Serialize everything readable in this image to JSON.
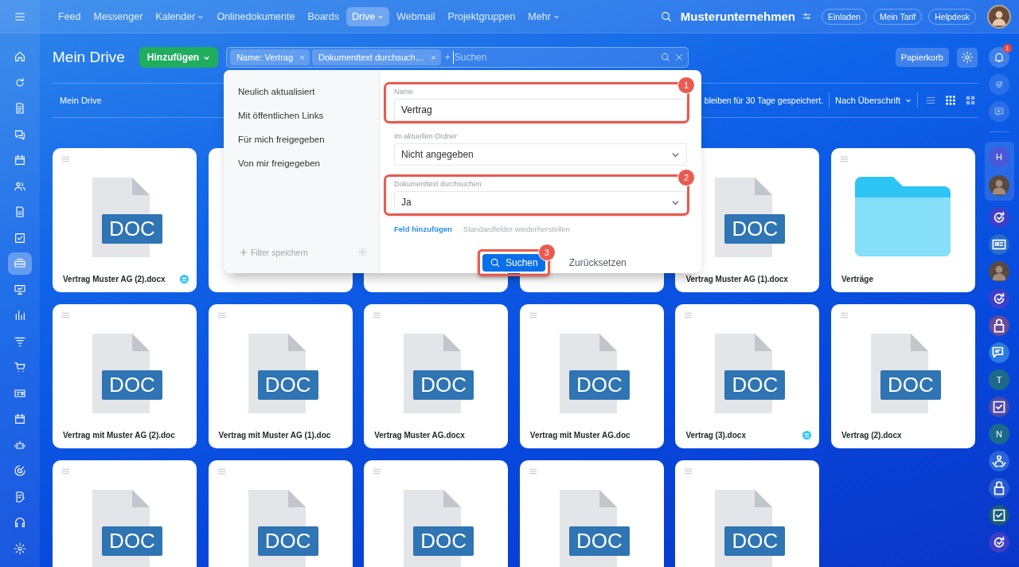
{
  "nav": {
    "items": [
      {
        "label": "Feed",
        "selected": false,
        "dropdown": false
      },
      {
        "label": "Messenger",
        "selected": false,
        "dropdown": false
      },
      {
        "label": "Kalender",
        "selected": false,
        "dropdown": true
      },
      {
        "label": "Onlinedokumente",
        "selected": false,
        "dropdown": false
      },
      {
        "label": "Boards",
        "selected": false,
        "dropdown": false
      },
      {
        "label": "Drive",
        "selected": true,
        "dropdown": true
      },
      {
        "label": "Webmail",
        "selected": false,
        "dropdown": false
      },
      {
        "label": "Projektgruppen",
        "selected": false,
        "dropdown": false
      },
      {
        "label": "Mehr",
        "selected": false,
        "dropdown": true
      }
    ],
    "company": "Musterunternehmen",
    "buttons": [
      "Einladen",
      "Mein Tarif",
      "Helpdesk"
    ]
  },
  "sidebar": [
    {
      "kind": "home",
      "selected": false
    },
    {
      "kind": "refresh",
      "selected": false
    },
    {
      "kind": "document",
      "selected": false
    },
    {
      "kind": "chat",
      "selected": false
    },
    {
      "kind": "calendar",
      "selected": false
    },
    {
      "kind": "people",
      "selected": false
    },
    {
      "kind": "file",
      "selected": false
    },
    {
      "kind": "checkbox",
      "selected": false
    },
    {
      "kind": "drive",
      "selected": true
    },
    {
      "kind": "presentation",
      "selected": false
    },
    {
      "kind": "bars",
      "selected": false
    },
    {
      "kind": "funnel",
      "selected": false
    },
    {
      "kind": "cart",
      "selected": false
    },
    {
      "kind": "card",
      "selected": false
    },
    {
      "kind": "calendar",
      "selected": false
    },
    {
      "kind": "robot",
      "selected": false
    },
    {
      "kind": "target",
      "selected": false
    },
    {
      "kind": "sign",
      "selected": false
    },
    {
      "kind": "headset",
      "selected": false
    },
    {
      "kind": "gear",
      "selected": false
    }
  ],
  "header": {
    "title": "Mein Drive",
    "add_button": "Hinzufügen",
    "search": {
      "chips": [
        "Name: Vertrag",
        "Dokumenttext durchsuch…"
      ],
      "plus": "+",
      "placeholder": "Suchen"
    },
    "trash_button": "Papierkorb"
  },
  "toolbar": {
    "breadcrumb": "Mein Drive",
    "notice": "bleiben für 30 Tage gespeichert.",
    "sort": "Nach Überschrift",
    "views": [
      {
        "kind": "list",
        "selected": false
      },
      {
        "kind": "grid",
        "selected": true
      },
      {
        "kind": "tiles",
        "selected": false
      }
    ]
  },
  "files": [
    {
      "kind": "doc",
      "label": "DOC",
      "name": "Vertrag Muster AG (2).docx",
      "shared": true
    },
    {
      "kind": "covered"
    },
    {
      "kind": "covered"
    },
    {
      "kind": "covered"
    },
    {
      "kind": "doc",
      "label": "DOC",
      "name": "Vertrag Muster AG (1).docx",
      "shared": false
    },
    {
      "kind": "folder",
      "name": "Verträge",
      "shared": false
    },
    {
      "kind": "doc",
      "label": "DOC",
      "name": "Vertrag mit Muster AG (2).doc",
      "shared": false
    },
    {
      "kind": "doc",
      "label": "DOC",
      "name": "Vertrag mit Muster AG (1).doc",
      "shared": false
    },
    {
      "kind": "doc",
      "label": "DOC",
      "name": "Vertrag Muster AG.docx",
      "shared": false
    },
    {
      "kind": "doc",
      "label": "DOC",
      "name": "Vertrag mit Muster AG.doc",
      "shared": false
    },
    {
      "kind": "doc",
      "label": "DOC",
      "name": "Vertrag (3).docx",
      "shared": true
    },
    {
      "kind": "doc",
      "label": "DOC",
      "name": "Vertrag (2).docx",
      "shared": false
    },
    {
      "kind": "doc",
      "label": "DOC"
    },
    {
      "kind": "doc",
      "label": "DOC"
    },
    {
      "kind": "doc",
      "label": "DOC"
    },
    {
      "kind": "doc",
      "label": "DOC"
    },
    {
      "kind": "doc",
      "label": "DOC"
    }
  ],
  "filter_popup": {
    "presets": [
      "Neulich aktualisiert",
      "Mit öffentlichen Links",
      "Für mich freigegeben",
      "Von mir freigegeben"
    ],
    "save_filter": "Filter speichern",
    "fields": [
      {
        "label": "Name",
        "kind": "text",
        "value": "Vertrag",
        "marker": "1"
      },
      {
        "label": "Im aktuellen Ordner",
        "kind": "select",
        "value": "Nicht angegeben"
      },
      {
        "label": "Dokumenttext durchsuchen",
        "kind": "select",
        "value": "Ja",
        "marker": "2"
      }
    ],
    "add_field": "Feld hinzufügen",
    "restore": "Standardfelder wiederherstellen",
    "search_button": "Suchen",
    "search_marker": "3",
    "reset_button": "Zurücksetzen"
  },
  "right_rail": {
    "notifications": "1",
    "pinned": [
      {
        "kind": "letter",
        "text": "H",
        "color": "#4a58d8"
      },
      {
        "kind": "avatar"
      }
    ],
    "items": [
      {
        "kind": "sync",
        "color": "#3d3fc8"
      },
      {
        "kind": "card",
        "color": "#2a6cc8"
      },
      {
        "kind": "avatar"
      },
      {
        "kind": "sync",
        "color": "#3d3fc8"
      },
      {
        "kind": "lock",
        "color": "#6a4a9a"
      },
      {
        "kind": "chat",
        "color": "#2a7ae0"
      },
      {
        "kind": "letter",
        "text": "T",
        "color": "#1f6a88"
      },
      {
        "kind": "check",
        "color": "#4f4aa8"
      },
      {
        "kind": "letter",
        "text": "N",
        "color": "#1a6a8e"
      },
      {
        "kind": "people",
        "color": "#2a66d8"
      },
      {
        "kind": "lock",
        "color": "#2a5ad0"
      },
      {
        "kind": "check",
        "color": "#1a5a7a"
      },
      {
        "kind": "sync",
        "color": "#3d3fc8"
      }
    ]
  }
}
